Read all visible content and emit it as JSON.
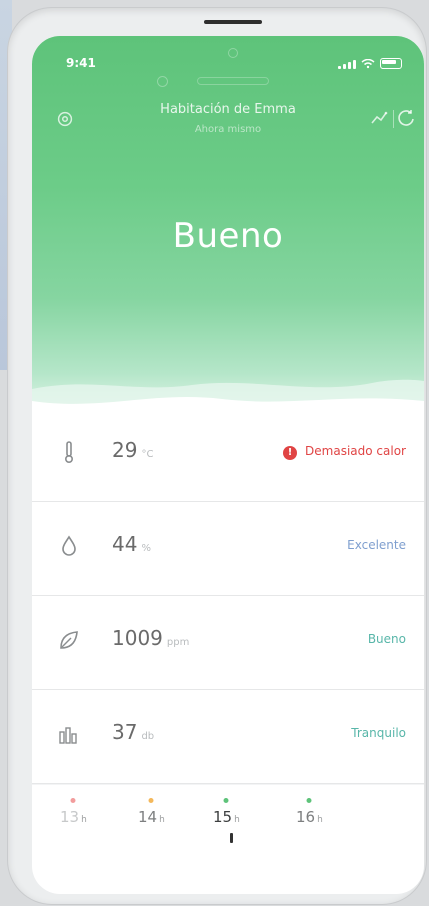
{
  "status_bar": {
    "time": "9:41"
  },
  "header": {
    "title": "Habitación de Emma",
    "subtitle": "Ahora mismo"
  },
  "hero": {
    "status": "Bueno"
  },
  "metrics": [
    {
      "name": "temperature",
      "value": "29",
      "unit": "°C",
      "status": "Demasiado calor",
      "icon": "thermometer-icon"
    },
    {
      "name": "humidity",
      "value": "44",
      "unit": "%",
      "status": "Excelente",
      "icon": "droplet-icon"
    },
    {
      "name": "co2",
      "value": "1009",
      "unit": "ppm",
      "status": "Bueno",
      "icon": "leaf-icon"
    },
    {
      "name": "noise",
      "value": "37",
      "unit": "db",
      "status": "Tranquilo",
      "icon": "city-icon"
    }
  ],
  "timeline": [
    {
      "label": "13",
      "suffix": "h"
    },
    {
      "label": "14",
      "suffix": "h"
    },
    {
      "label": "15",
      "suffix": "h"
    },
    {
      "label": "16",
      "suffix": "h"
    }
  ],
  "colors": {
    "accent": "#5ec37a",
    "warning": "#e04444",
    "ok_blue": "#7f9fcf",
    "ok_teal": "#58b6a9"
  }
}
